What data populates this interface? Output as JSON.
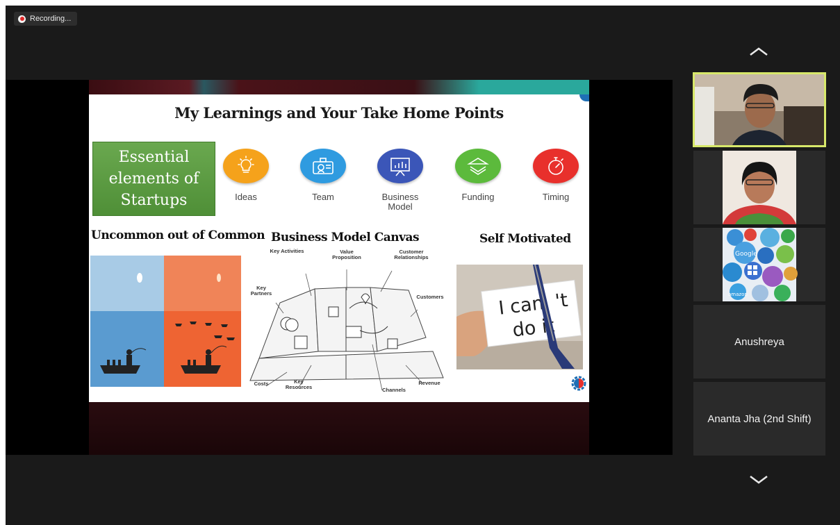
{
  "recording": {
    "label": "Recording..."
  },
  "slide": {
    "title": "My Learnings and Your Take Home Points",
    "essential_box": "Essential elements of Startups",
    "elements": [
      {
        "label": "Ideas",
        "color": "#f5a21b",
        "icon": "lightbulb-icon"
      },
      {
        "label": "Team",
        "color": "#2f9be0",
        "icon": "team-icon"
      },
      {
        "label": "Business Model",
        "color": "#3b56b8",
        "icon": "presentation-icon"
      },
      {
        "label": "Funding",
        "color": "#5cba3c",
        "icon": "funding-icon"
      },
      {
        "label": "Timing",
        "color": "#e8302c",
        "icon": "stopwatch-icon"
      }
    ],
    "section_uncommon": "Uncommon out of Common",
    "section_bmc": "Business Model Canvas",
    "section_motivated": "Self Motivated",
    "bmc_labels": {
      "key_activities": "Key Activities",
      "value_proposition": "Value Proposition",
      "customer_relationships": "Customer Relationships",
      "key_partners": "Key Partners",
      "customers": "Customers",
      "costs": "Costs",
      "key_resources": "Key Resources",
      "channels": "Channels",
      "revenue": "Revenue"
    },
    "motivated_card_text": "I can't do it"
  },
  "participants": [
    {
      "name": "",
      "type": "video",
      "active": true
    },
    {
      "name": "",
      "type": "video",
      "active": false
    },
    {
      "name": "",
      "type": "video",
      "active": false
    },
    {
      "name": "Anushreya",
      "type": "name",
      "active": false
    },
    {
      "name": "Ananta Jha (2nd Shift)",
      "type": "name",
      "active": false
    }
  ],
  "colors": {
    "active_speaker_border": "#d7e86a",
    "recording_dot": "#e02828",
    "essential_green": "#6aa84f"
  }
}
